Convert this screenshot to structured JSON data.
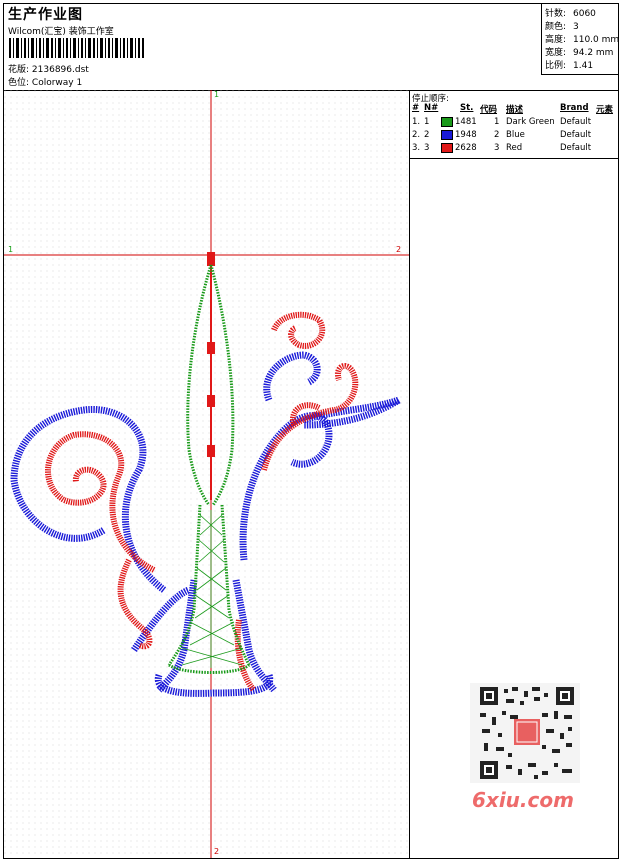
{
  "header": {
    "title": "生产作业图",
    "company": "Wilcom(汇宝) 装饰工作室",
    "file_label": "花版:",
    "file_value": "2136896.dst",
    "color_label": "色位:",
    "color_value": "Colorway 1"
  },
  "stats": {
    "stitches_label": "针数:",
    "stitches": "6060",
    "colors_label": "颜色:",
    "colors": "3",
    "height_label": "高度:",
    "height": "110.0 mm",
    "width_label": "宽度:",
    "width": "94.2 mm",
    "ratio_label": "比例:",
    "ratio": "1.41"
  },
  "stop_sequence": {
    "title": "停止顺序:",
    "columns": {
      "num": "#",
      "n": "N#",
      "st": "St.",
      "code": "代码",
      "desc": "描述",
      "brand": "Brand",
      "element": "元素"
    },
    "rows": [
      {
        "num": "1.",
        "n": "1",
        "color": "#1a9a1a",
        "st": "1481",
        "code": "1",
        "desc": "Dark Green",
        "brand": "Default"
      },
      {
        "num": "2.",
        "n": "2",
        "color": "#1a1ad8",
        "st": "1948",
        "code": "2",
        "desc": "Blue",
        "brand": "Default"
      },
      {
        "num": "3.",
        "n": "3",
        "color": "#e01818",
        "st": "2628",
        "code": "3",
        "desc": "Red",
        "brand": "Default"
      }
    ]
  },
  "axes": {
    "top": "1",
    "left": "1",
    "right": "2",
    "bottom": "2"
  },
  "watermark": "6xiu.com",
  "colors": {
    "green": "#1a9a1a",
    "blue": "#1a1ad8",
    "red": "#e01818",
    "guide": "#d00000"
  }
}
